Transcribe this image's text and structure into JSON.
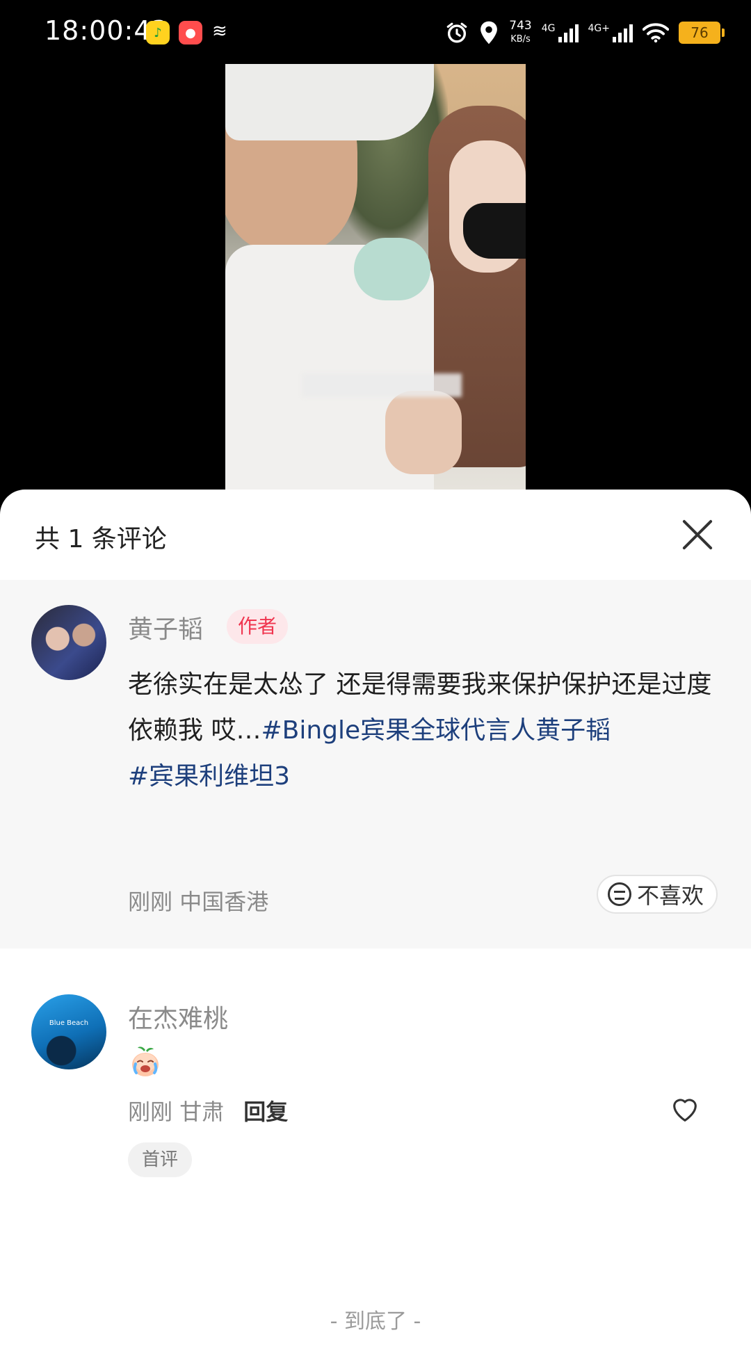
{
  "status_bar": {
    "time": "18:00:43",
    "app1_icon": "music-app-icon",
    "app2_icon": "kuaishou-app-icon",
    "misc_icon": "notification-icon",
    "alarm_icon": "alarm-icon",
    "location_icon": "location-icon",
    "net_speed_value": "743",
    "net_speed_unit": "KB/s",
    "sim1_label": "4G",
    "sim2_label": "4G+",
    "battery": "76",
    "battery_color": "#f5b11c"
  },
  "sheet": {
    "title": "共 1 条评论",
    "close_icon": "close-icon",
    "comments": [
      {
        "username": "黄子韬",
        "badge": "作者",
        "text": "老徐实在是太怂了 还是得需要我来保护保护还是过度依赖我 哎…",
        "tag1": "#Bingle宾果全球代言人黄子韬",
        "tag2": "#宾果利维坦3",
        "time": "刚刚",
        "location": "中国香港",
        "dislike_label": "不喜欢"
      },
      {
        "username": "在杰难桃",
        "avatar_text": "Blue Beach",
        "emoji": "crying-peach-emoji",
        "time": "刚刚",
        "location": "甘肃",
        "reply_label": "回复",
        "first_badge": "首评"
      }
    ],
    "end_text": "- 到底了 -"
  },
  "colors": {
    "hashtag": "#1d3f7c",
    "author_badge_bg": "#fde7ea",
    "author_badge_text": "#f0354f"
  }
}
